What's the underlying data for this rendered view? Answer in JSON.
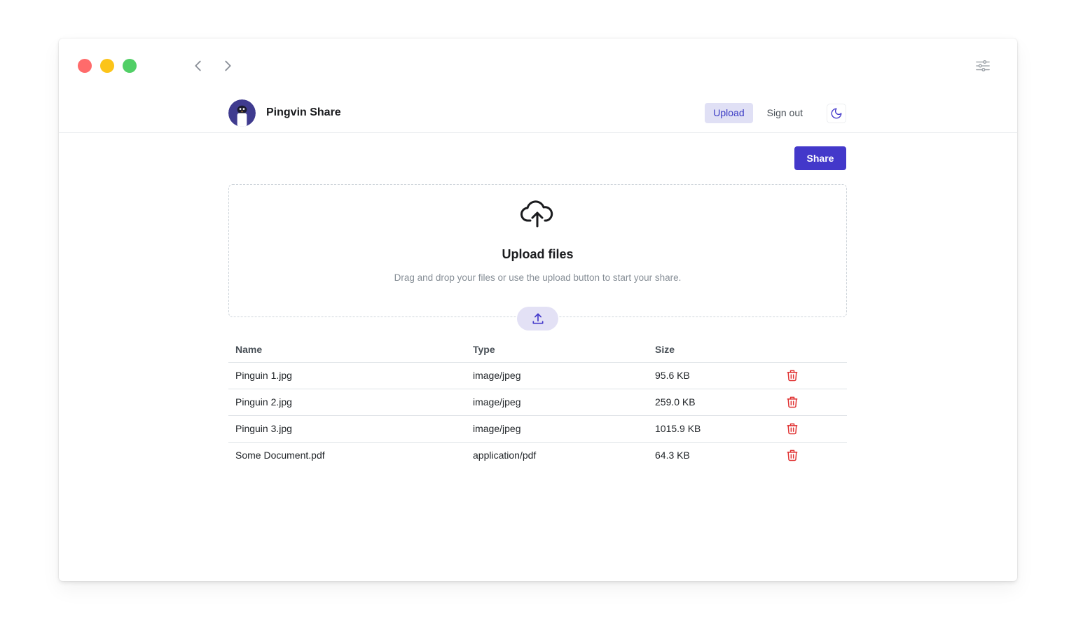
{
  "app": {
    "name": "Pingvin Share"
  },
  "nav": {
    "upload": "Upload",
    "sign_out": "Sign out"
  },
  "actions": {
    "share": "Share"
  },
  "dropzone": {
    "title": "Upload files",
    "subtitle": "Drag and drop your files or use the upload button to start your share."
  },
  "table": {
    "headers": [
      "Name",
      "Type",
      "Size"
    ],
    "rows": [
      {
        "name": "Pinguin 1.jpg",
        "type": "image/jpeg",
        "size": "95.6 KB"
      },
      {
        "name": "Pinguin 2.jpg",
        "type": "image/jpeg",
        "size": "259.0 KB"
      },
      {
        "name": "Pinguin 3.jpg",
        "type": "image/jpeg",
        "size": "1015.9 KB"
      },
      {
        "name": "Some Document.pdf",
        "type": "application/pdf",
        "size": "64.3 KB"
      }
    ]
  },
  "colors": {
    "accent": "#4338ca",
    "danger": "#e03131",
    "traffic_red": "#ff6b6b",
    "traffic_yellow": "#fcc419",
    "traffic_green": "#51cf66"
  },
  "icons": [
    "chevron-left-icon",
    "chevron-right-icon",
    "settings-sliders-icon",
    "moon-icon",
    "cloud-upload-icon",
    "upload-icon",
    "trash-icon"
  ]
}
